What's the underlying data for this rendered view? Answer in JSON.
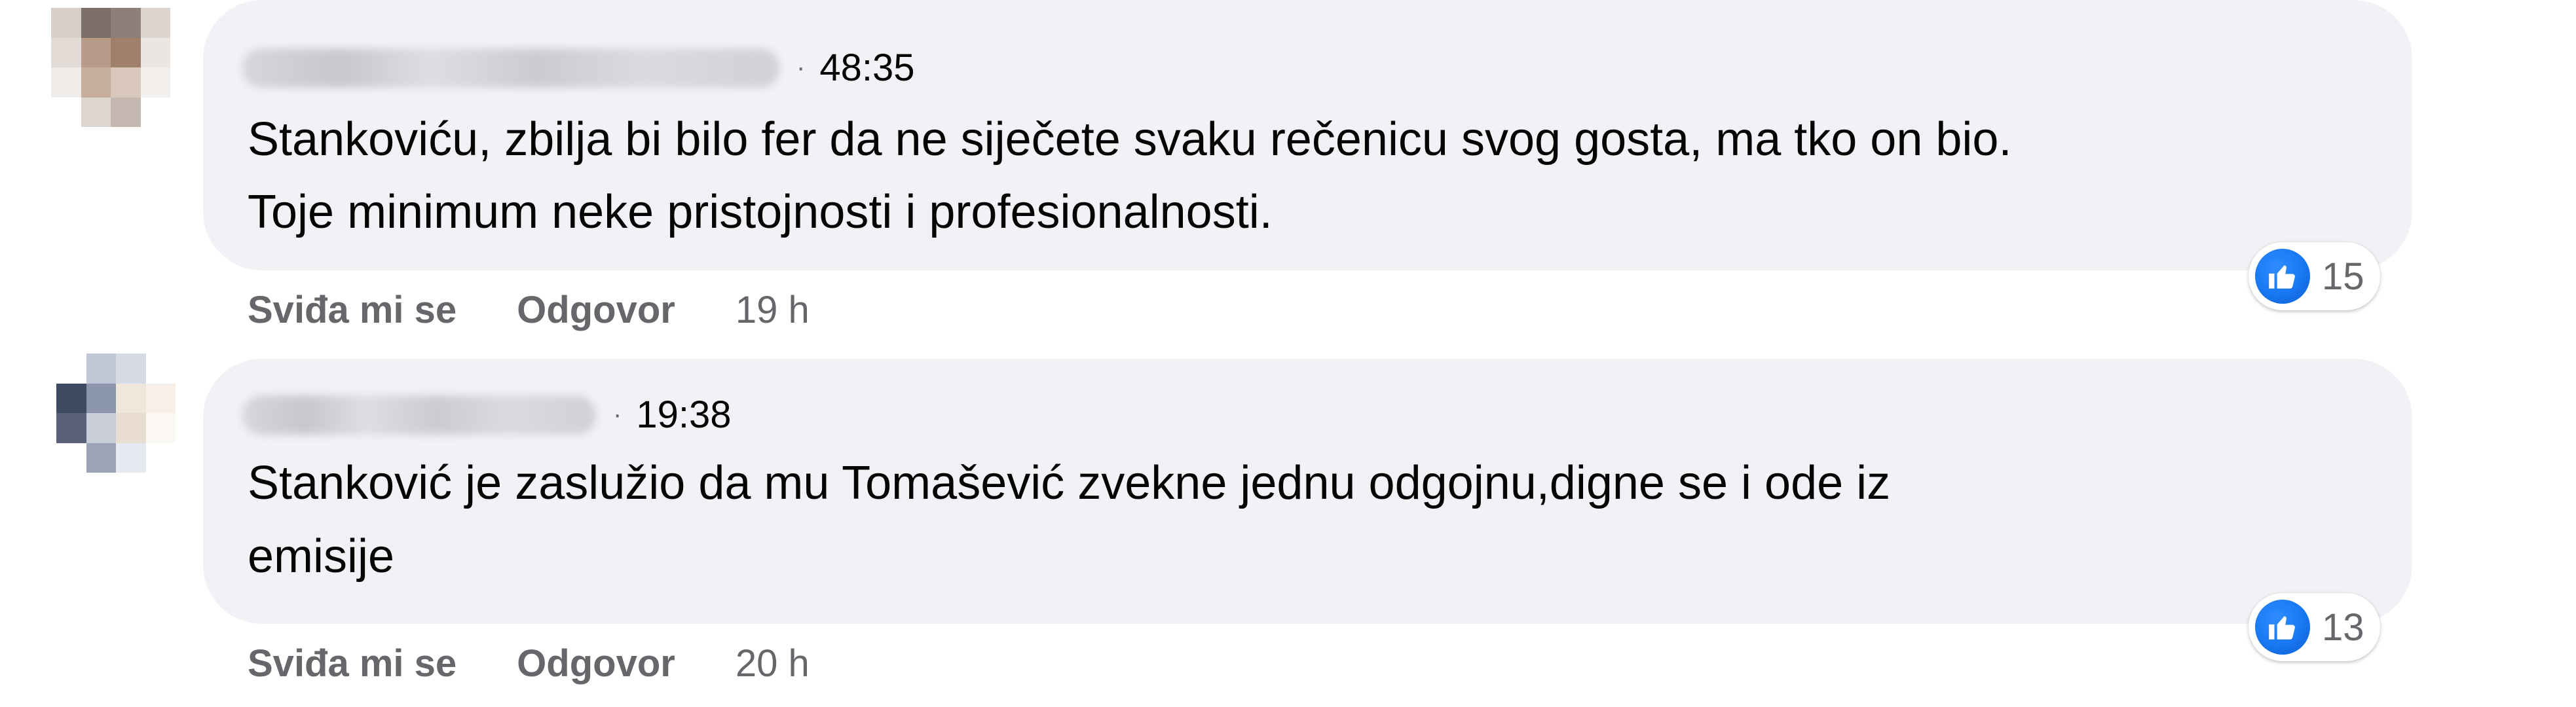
{
  "comments": [
    {
      "time": "48:35",
      "text_line1": "Stankoviću, zbilja bi bilo fer da ne siječete svaku rečenicu svog gosta, ma tko on bio.",
      "text_line2": "Toje minimum neke pristojnosti i profesionalnosti.",
      "reaction_count": "15",
      "like_label": "Sviđa mi se",
      "reply_label": "Odgovor",
      "age": "19 h"
    },
    {
      "time": "19:38",
      "text_line1": "Stanković je zaslužio da mu Tomašević zvekne jednu odgojnu,digne se i ode iz",
      "text_line2": "emisije",
      "reaction_count": "13",
      "like_label": "Sviđa mi se",
      "reply_label": "Odgovor",
      "age": "20 h"
    }
  ],
  "colors": {
    "bubble": "#f0f2f5",
    "like_blue": "#1877f2",
    "secondary_text": "#65676b"
  },
  "icons": {
    "reaction": "thumbs-up-icon"
  }
}
